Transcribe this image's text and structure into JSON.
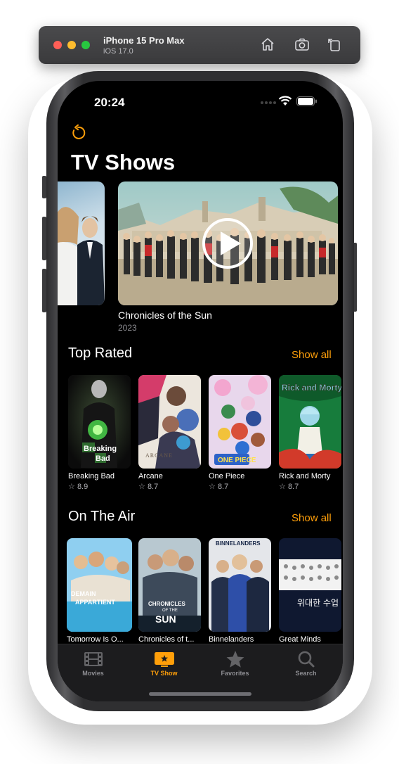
{
  "simulator": {
    "device_name": "iPhone 15 Pro Max",
    "os_version": "iOS 17.0",
    "icons": [
      "home-icon",
      "screenshot-icon",
      "rotate-icon"
    ]
  },
  "status_bar": {
    "time": "20:24"
  },
  "header": {
    "title": "TV Shows",
    "refresh_icon": "refresh-icon"
  },
  "featured": {
    "title": "Chronicles of the Sun",
    "year": "2023"
  },
  "sections": [
    {
      "title": "Top Rated",
      "show_all": "Show all",
      "items": [
        {
          "title": "Breaking Bad",
          "rating": "8.9",
          "poster_text": "Br eaking Ba d"
        },
        {
          "title": "Arcane",
          "rating": "8.7",
          "poster_text": "ARCANE"
        },
        {
          "title": "One Piece",
          "rating": "8.7",
          "poster_text": "ONE PIECE"
        },
        {
          "title": "Rick and Morty",
          "rating": "8.7",
          "poster_text": "Rick and Morty"
        }
      ]
    },
    {
      "title": "On The Air",
      "show_all": "Show all",
      "items": [
        {
          "title": "Tomorrow Is O...",
          "poster_text": "DEMAIN APPARTIENT"
        },
        {
          "title": "Chronicles of t...",
          "poster_text": "CHRONICLES OF THE SUN"
        },
        {
          "title": "Binnelanders",
          "poster_text": "BINNELANDERS"
        },
        {
          "title": "Great Minds",
          "poster_text": "위대한 수업"
        }
      ]
    }
  ],
  "tab_bar": {
    "items": [
      {
        "label": "Movies",
        "icon": "film-icon",
        "selected": false
      },
      {
        "label": "TV Show",
        "icon": "tv-icon",
        "selected": true
      },
      {
        "label": "Favorites",
        "icon": "star-icon",
        "selected": false
      },
      {
        "label": "Search",
        "icon": "search-icon",
        "selected": false
      }
    ]
  },
  "colors": {
    "accent": "#ff9f0a",
    "background": "#000000",
    "secondary_text": "#8e8e93"
  }
}
